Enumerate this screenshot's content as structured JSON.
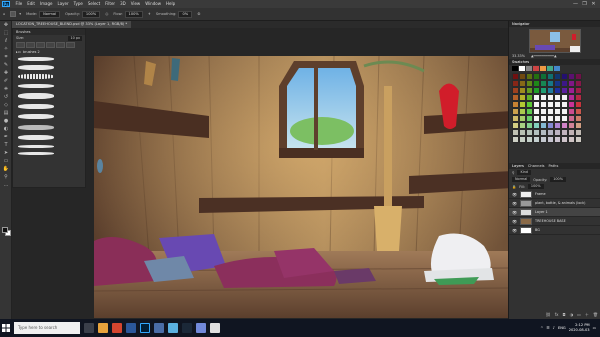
{
  "app": {
    "name": "Adobe Photoshop",
    "logo_text": "Ps"
  },
  "menu": [
    "File",
    "Edit",
    "Image",
    "Layer",
    "Type",
    "Select",
    "Filter",
    "3D",
    "View",
    "Window",
    "Help"
  ],
  "window_controls": [
    "—",
    "❐",
    "✕"
  ],
  "options_bar": {
    "mode_label": "Mode:",
    "mode_value": "Normal",
    "opacity_label": "Opacity:",
    "opacity_value": "100%",
    "flow_label": "Flow:",
    "flow_value": "100%",
    "smoothing_label": "Smoothing:",
    "smoothing_value": "0%"
  },
  "document_tab": "LOCATION_TREEHOUSE_BLEND.psd @ 33% (Layer 1, RGB/8) *",
  "tools": [
    "move-icon",
    "marquee-icon",
    "lasso-icon",
    "wand-icon",
    "crop-icon",
    "eyedropper-icon",
    "heal-icon",
    "brush-icon",
    "stamp-icon",
    "history-brush-icon",
    "eraser-icon",
    "gradient-icon",
    "blur-icon",
    "dodge-icon",
    "pen-icon",
    "type-icon",
    "path-select-icon",
    "shape-icon",
    "hand-icon",
    "zoom-icon",
    "more-icon"
  ],
  "tool_glyphs": [
    "✥",
    "⬚",
    "ℓ",
    "✧",
    "⌗",
    "✎",
    "✚",
    "✐",
    "⎈",
    "↺",
    "◇",
    "▤",
    "●",
    "◐",
    "✒",
    "T",
    "➤",
    "▭",
    "✋",
    "⚲",
    "…"
  ],
  "brushes_panel": {
    "title": "Brushes",
    "size_label": "Size:",
    "size_value": "10 px",
    "folder_name": "brushes 2"
  },
  "navigator": {
    "title": "Navigator",
    "zoom": "33.33%"
  },
  "swatches": {
    "tabs": [
      "Swatches"
    ]
  },
  "layers_panel": {
    "tabs": [
      "Layers",
      "Channels",
      "Paths"
    ],
    "kind_label": "Kind",
    "blend_mode": "Normal",
    "opacity_label": "Opacity:",
    "opacity_value": "100%",
    "fill_label": "Fill:",
    "fill_value": "100%",
    "layers": [
      {
        "name": "Frame",
        "selected": false
      },
      {
        "name": "plant, bottle, & animals (lock)",
        "selected": false
      },
      {
        "name": "Layer 1",
        "selected": true
      },
      {
        "name": "TREEHOUSE BASE",
        "selected": false
      },
      {
        "name": "BG",
        "selected": false
      }
    ]
  },
  "taskbar": {
    "search_placeholder": "Type here to search",
    "language": "ENG",
    "time": "2:12 PM",
    "date": "2020-08-03"
  },
  "colors": {
    "accent": "#31a8ff",
    "panel": "#323232",
    "canvas_bg": "#262626"
  }
}
